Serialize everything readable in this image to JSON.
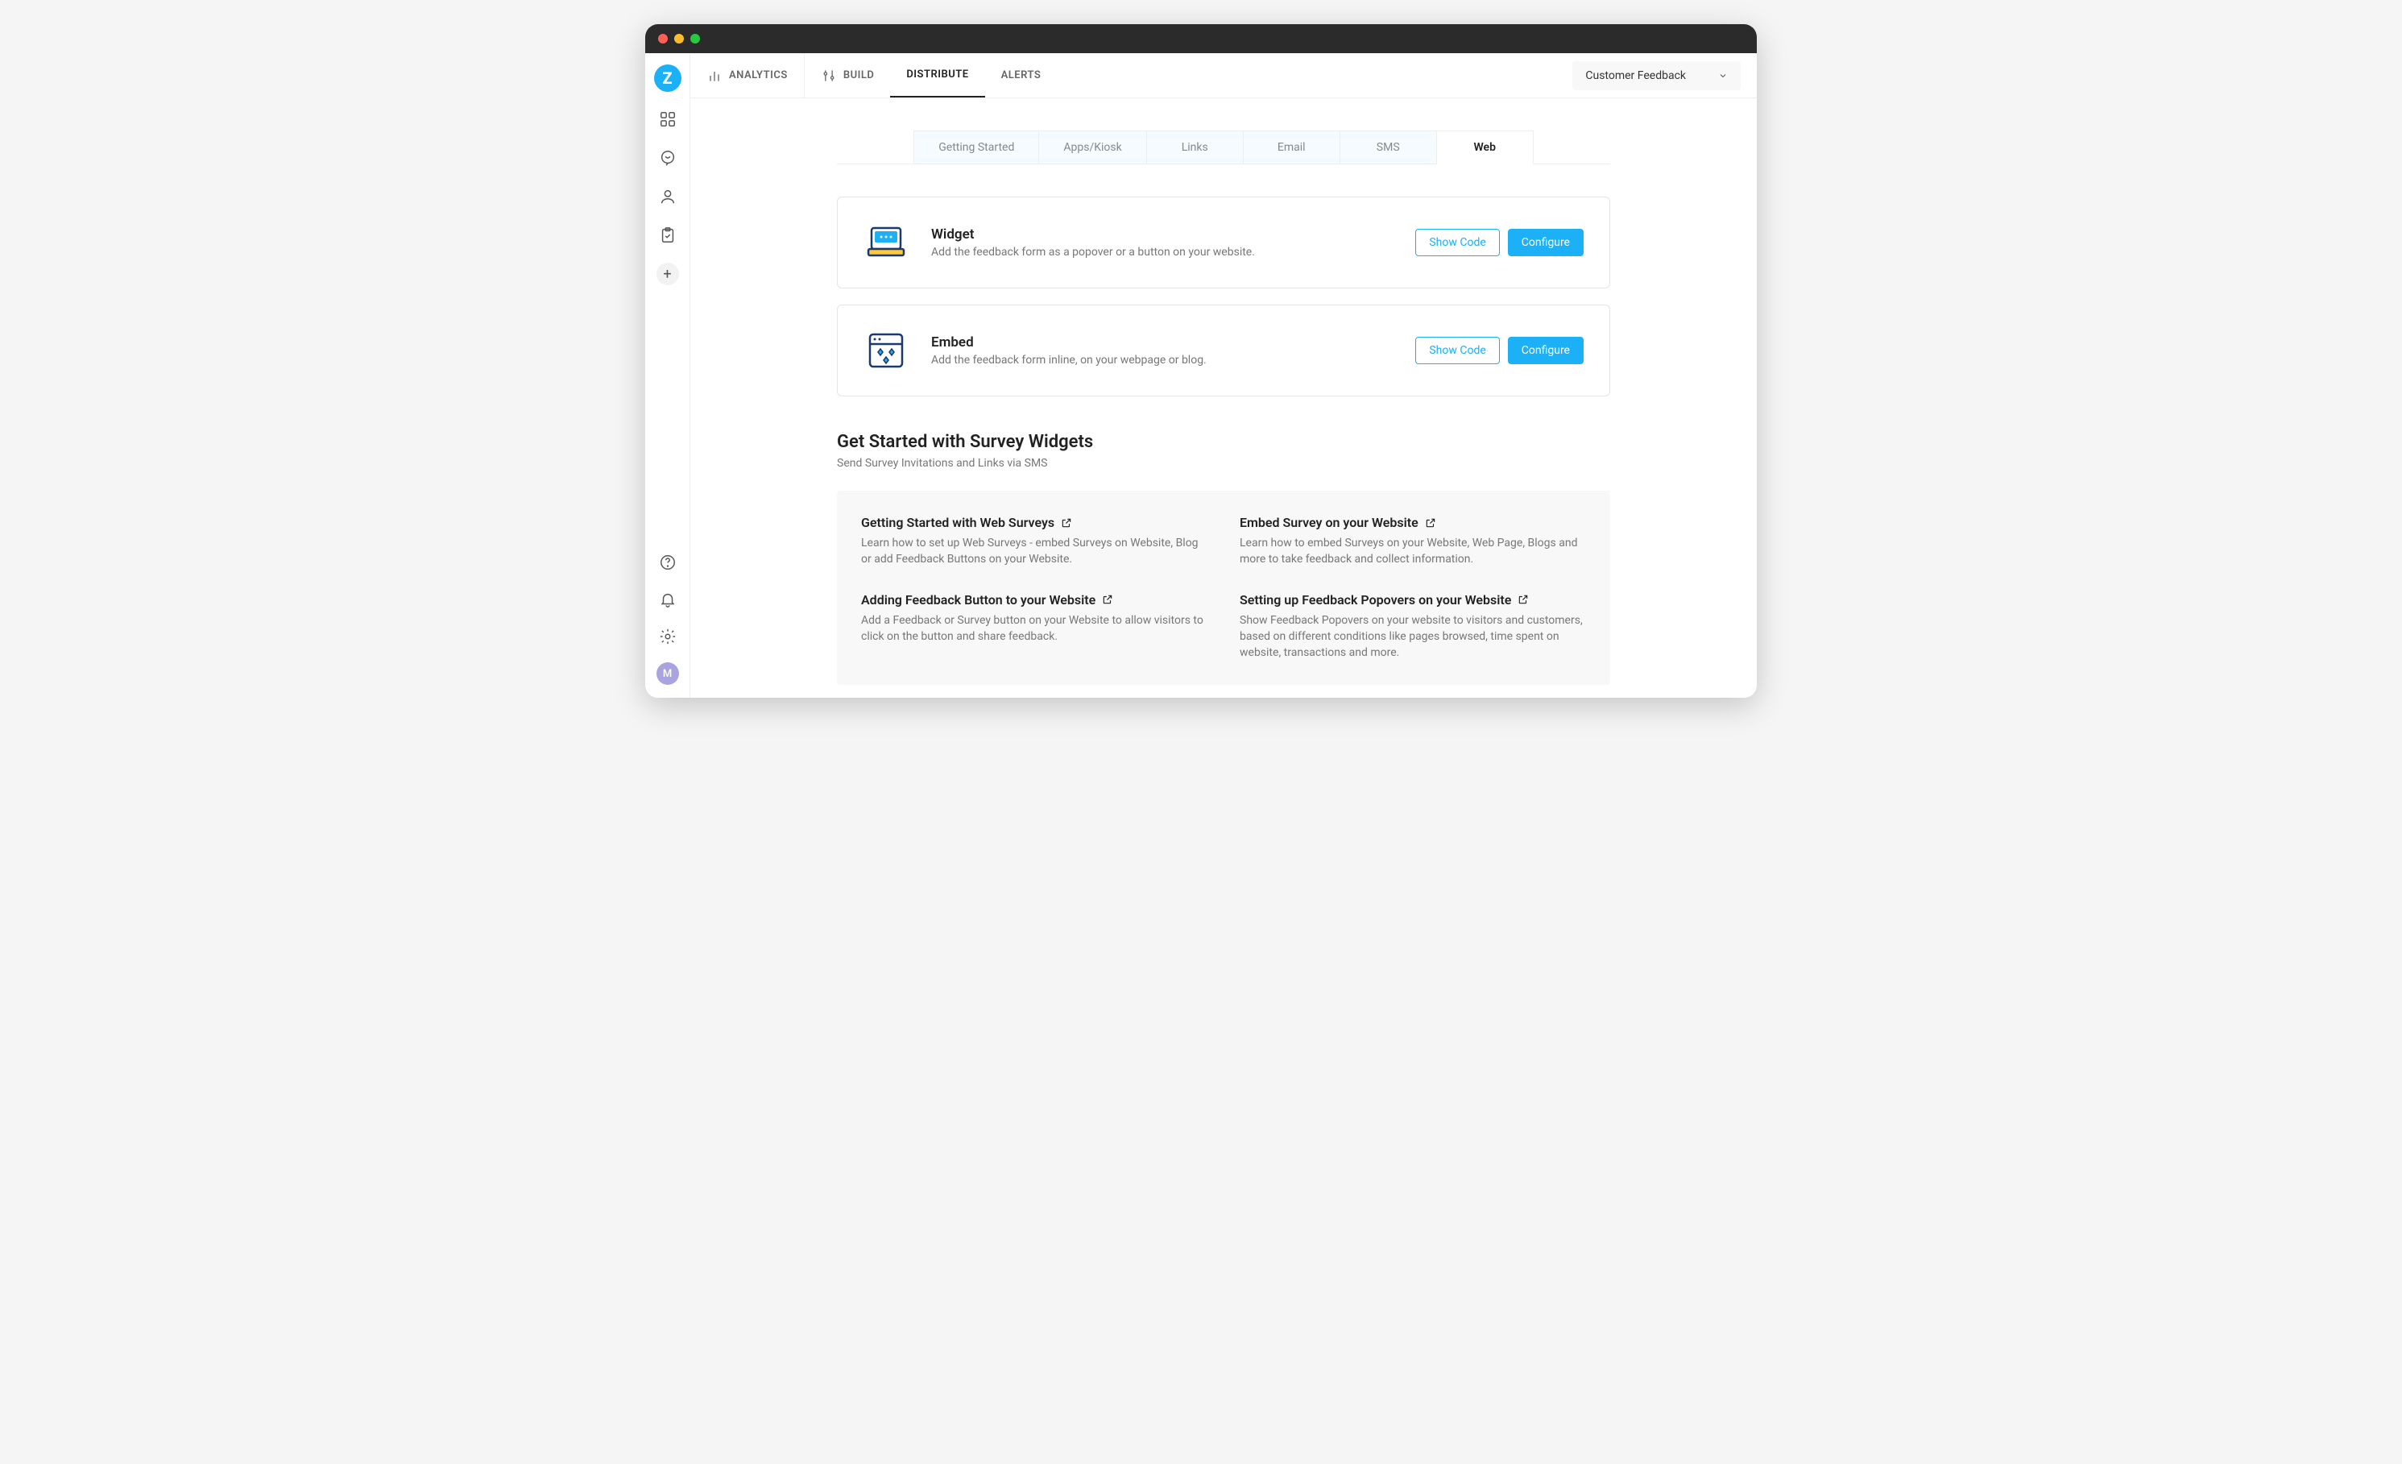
{
  "topnav": {
    "analytics": "ANALYTICS",
    "build": "BUILD",
    "distribute": "DISTRIBUTE",
    "alerts": "ALERTS"
  },
  "dropdown": {
    "selected": "Customer Feedback"
  },
  "tabs": {
    "getting_started": "Getting Started",
    "apps_kiosk": "Apps/Kiosk",
    "links": "Links",
    "email": "Email",
    "sms": "SMS",
    "web": "Web"
  },
  "widget_card": {
    "title": "Widget",
    "desc": "Add the feedback form as a popover or a button on your website.",
    "show_code": "Show Code",
    "configure": "Configure"
  },
  "embed_card": {
    "title": "Embed",
    "desc": "Add the feedback form inline, on your webpage or blog.",
    "show_code": "Show Code",
    "configure": "Configure"
  },
  "section": {
    "title": "Get Started with Survey Widgets",
    "sub": "Send Survey Invitations and Links via SMS"
  },
  "help": {
    "a": {
      "title": "Getting Started with Web Surveys",
      "desc": "Learn how to set up Web Surveys - embed Surveys on Website, Blog or add Feedback Buttons on your Website."
    },
    "b": {
      "title": "Embed Survey on your Website",
      "desc": "Learn how to embed Surveys on your Website, Web Page, Blogs and more to take feedback and collect information."
    },
    "c": {
      "title": "Adding Feedback Button to your Website",
      "desc": "Add a Feedback or Survey button on your Website to allow visitors to click on the button and share feedback."
    },
    "d": {
      "title": "Setting up Feedback Popovers on your Website",
      "desc": "Show Feedback Popovers on your website to visitors and customers, based on different conditions like pages browsed, time spent on website, transactions and more."
    }
  },
  "avatar": "M"
}
